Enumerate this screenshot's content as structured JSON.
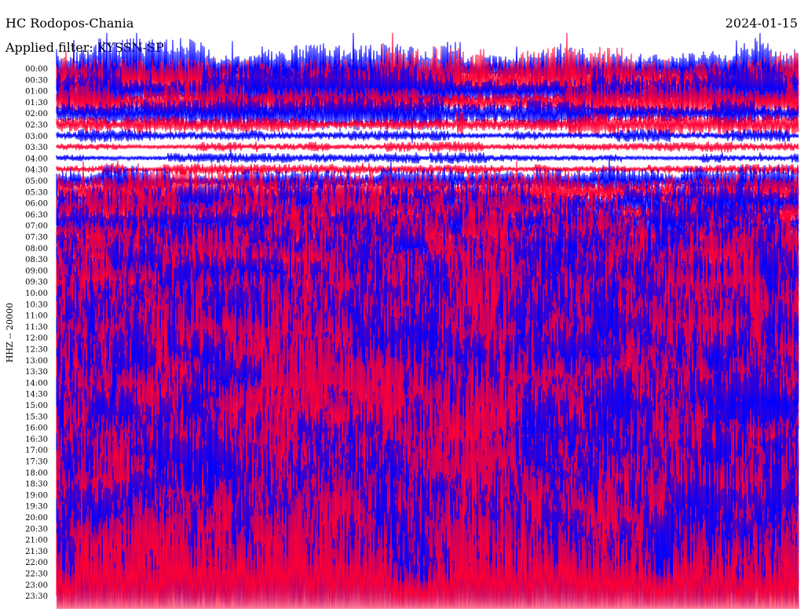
{
  "header": {
    "station": "HC Rodopos-Chania",
    "date": "2024-01-15",
    "filter": "Applied filter: KYSSN-SP",
    "channel": "HHZ -- 20000"
  },
  "chart_data": {
    "type": "line",
    "title": "HC Rodopos-Chania",
    "date": "2024-01-15",
    "ylabel": "HHZ -- 20000",
    "row_labels": [
      "00:00",
      "00:30",
      "01:00",
      "01:30",
      "02:00",
      "02:30",
      "03:00",
      "03:30",
      "04:00",
      "04:30",
      "05:00",
      "05:30",
      "06:00",
      "06:30",
      "07:00",
      "07:30",
      "08:00",
      "08:30",
      "09:00",
      "09:30",
      "10:00",
      "10:30",
      "11:00",
      "11:30",
      "12:00",
      "12:30",
      "13:00",
      "13:30",
      "14:00",
      "14:30",
      "15:00",
      "15:30",
      "16:00",
      "16:30",
      "17:00",
      "17:30",
      "18:00",
      "18:30",
      "19:00",
      "19:30",
      "20:00",
      "20:30",
      "21:00",
      "21:30",
      "22:00",
      "22:30",
      "23:00",
      "23:30"
    ],
    "series_colors": [
      "#0000ff",
      "#ff0033"
    ],
    "relative_amplitude": [
      1.7,
      2.0,
      1.6,
      1.3,
      0.9,
      0.7,
      0.35,
      0.3,
      0.3,
      0.3,
      0.8,
      1.5,
      1.5,
      1.8,
      1.6,
      1.6,
      1.7,
      1.9,
      2.2,
      2.7,
      2.8,
      3.0,
      3.0,
      3.0,
      3.2,
      3.0,
      3.0,
      2.9,
      3.2,
      3.0,
      2.8,
      2.9,
      3.1,
      3.1,
      3.3,
      3.3,
      3.3,
      3.4,
      3.4,
      3.5,
      3.4,
      3.5,
      3.5,
      3.6,
      3.7,
      3.9,
      4.3,
      4.5
    ],
    "grid": false,
    "legend": "none"
  }
}
